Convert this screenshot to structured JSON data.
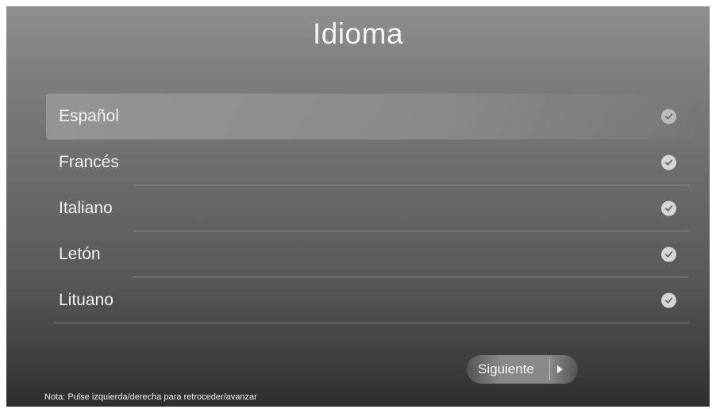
{
  "title": "Idioma",
  "languages": [
    {
      "label": "Español",
      "selected": true,
      "checked": true
    },
    {
      "label": "Francés",
      "selected": false,
      "checked": true
    },
    {
      "label": "Italiano",
      "selected": false,
      "checked": true
    },
    {
      "label": "Letón",
      "selected": false,
      "checked": true
    },
    {
      "label": "Lituano",
      "selected": false,
      "checked": true
    }
  ],
  "next_button": {
    "label": "Siguiente",
    "icon": "arrow-right-icon"
  },
  "note": "Nota: Pulse izquierda/derecha para retroceder/avanzar",
  "colors": {
    "text": "#f2f2f2",
    "check_bg": "#d6d6d6",
    "check_mark": "#6a6a6a"
  }
}
